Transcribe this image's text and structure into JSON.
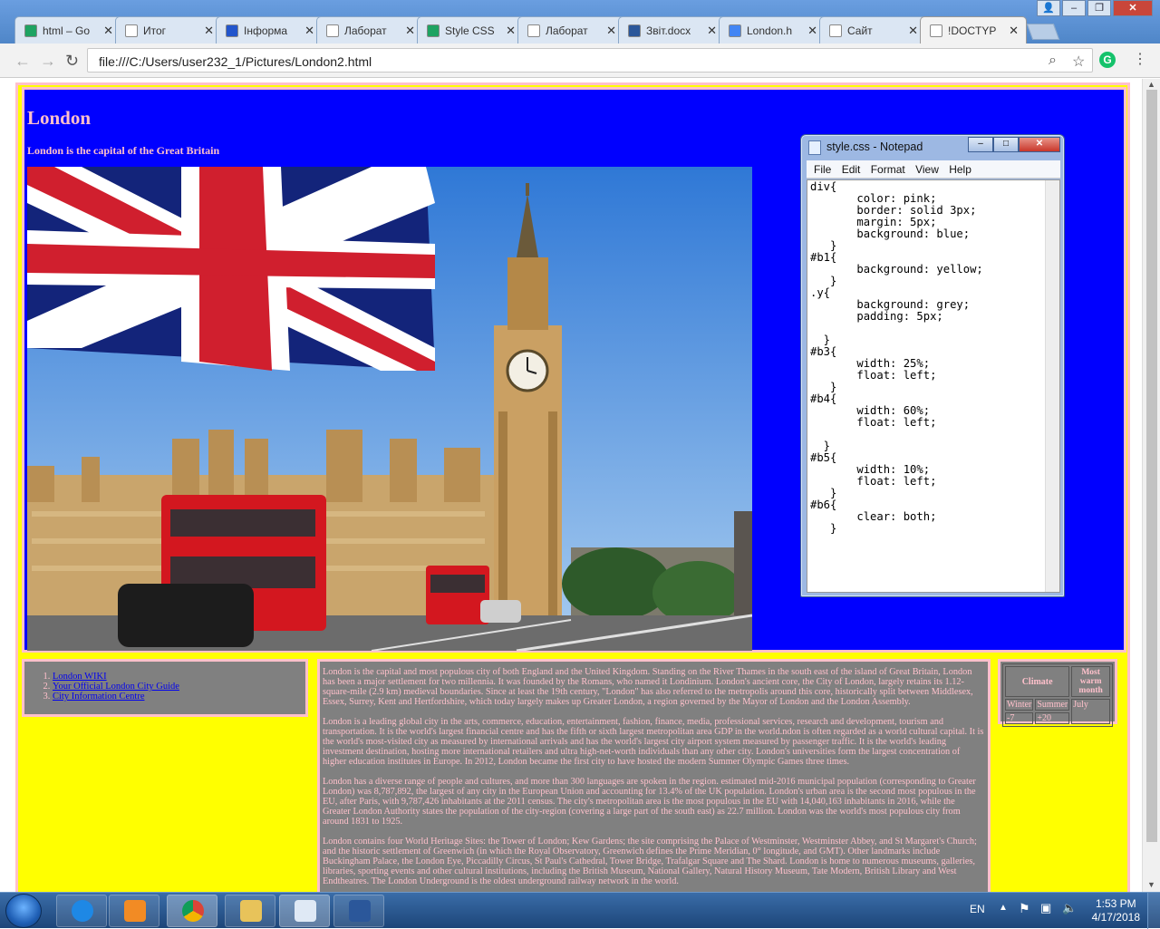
{
  "browser": {
    "tabs": [
      {
        "label": "html – Go",
        "icon": "drive-icon",
        "color": "#1ea362"
      },
      {
        "label": "Итог",
        "icon": "document-icon",
        "color": "#ffffff"
      },
      {
        "label": "Інформа",
        "icon": "lyb-icon",
        "color": "#2255cc"
      },
      {
        "label": "Лаборат",
        "icon": "document-icon",
        "color": "#ffffff"
      },
      {
        "label": "Style CSS",
        "icon": "drive-icon",
        "color": "#1ea362"
      },
      {
        "label": "Лаборат",
        "icon": "document-icon",
        "color": "#ffffff"
      },
      {
        "label": "Звіт.docx",
        "icon": "word-icon",
        "color": "#2b579a"
      },
      {
        "label": "London.h",
        "icon": "docs-icon",
        "color": "#4285f4"
      },
      {
        "label": "Сайт",
        "icon": "document-icon",
        "color": "#ffffff"
      },
      {
        "label": "!DOCTYP",
        "icon": "document-icon",
        "color": "#ffffff"
      }
    ],
    "active_tab": 9,
    "url": "file:///C:/Users/user232_1/Pictures/London2.html"
  },
  "page": {
    "title": "London",
    "subtitle": "London is the capital of the Great Britain",
    "links": [
      "London WIKI",
      "Your Official London City Guide",
      "City Information Centre"
    ],
    "paragraphs": [
      "London is the capital and most populous city of both England and the United Kingdom. Standing on the River Thames in the south east of the island of Great Britain, London has been a major settlement for two millennia. It was founded by the Romans, who named it Londinium. London's ancient core, the City of London, largely retains its 1.12-square-mile (2.9 km) medieval boundaries. Since at least the 19th century, \"London\" has also referred to the metropolis around this core, historically split between Middlesex, Essex, Surrey, Kent and Hertfordshire, which today largely makes up Greater London, a region governed by the Mayor of London and the London Assembly.",
      "London is a leading global city in the arts, commerce, education, entertainment, fashion, finance, media, professional services, research and development, tourism and transportation. It is the world's largest financial centre and has the fifth or sixth largest metropolitan area GDP in the world.ndon is often regarded as a world cultural capital. It is the world's most-visited city as measured by international arrivals and has the world's largest city airport system measured by passenger traffic. It is the world's leading investment destination, hosting more international retailers and ultra high-net-worth individuals than any other city. London's universities form the largest concentration of higher education institutes in Europe. In 2012, London became the first city to have hosted the modern Summer Olympic Games three times.",
      "London has a diverse range of people and cultures, and more than 300 languages are spoken in the region. estimated mid-2016 municipal population (corresponding to Greater London) was 8,787,892, the largest of any city in the European Union and accounting for 13.4% of the UK population. London's urban area is the second most populous in the EU, after Paris, with 9,787,426 inhabitants at the 2011 census. The city's metropolitan area is the most populous in the EU with 14,040,163 inhabitants in 2016, while the Greater London Authority states the population of the city-region (covering a large part of the south east) as 22.7 million. London was the world's most populous city from around 1831 to 1925.",
      "London contains four World Heritage Sites: the Tower of London; Kew Gardens; the site comprising the Palace of Westminster, Westminster Abbey, and St Margaret's Church; and the historic settlement of Greenwich (in which the Royal Observatory, Greenwich defines the Prime Meridian, 0° longitude, and GMT). Other landmarks include Buckingham Palace, the London Eye, Piccadilly Circus, St Paul's Cathedral, Tower Bridge, Trafalgar Square and The Shard. London is home to numerous museums, galleries, libraries, sporting events and other cultural institutions, including the British Museum, National Gallery, Natural History Museum, Tate Modern, British Library and West Endtheatres. The London Underground is the oldest underground railway network in the world."
    ],
    "climate_table": {
      "header_climate": "Climate",
      "header_warm": "Most warm month",
      "winter": "Winter",
      "summer": "Summer",
      "month": "July",
      "winter_val": "-7",
      "summer_val": "+20"
    }
  },
  "notepad": {
    "title": "style.css - Notepad",
    "menu": [
      "File",
      "Edit",
      "Format",
      "View",
      "Help"
    ],
    "content": "div{\n       color: pink;\n       border: solid 3px;\n       margin: 5px;\n       background: blue;\n   }\n#b1{\n       background: yellow;\n   }\n.y{\n       background: grey;\n       padding: 5px;\n\n  }\n#b3{\n       width: 25%;\n       float: left;\n   }\n#b4{\n       width: 60%;\n       float: left;\n\n  }\n#b5{\n       width: 10%;\n       float: left;\n   }\n#b6{\n       clear: both;\n   }"
  },
  "taskbar": {
    "lang": "EN",
    "time": "1:53 PM",
    "date": "4/17/2018"
  },
  "colors": {
    "page_blue": "#0000ff",
    "page_yellow": "#ffff00",
    "text_pink": "#ffc0cb",
    "box_grey": "#808080"
  }
}
